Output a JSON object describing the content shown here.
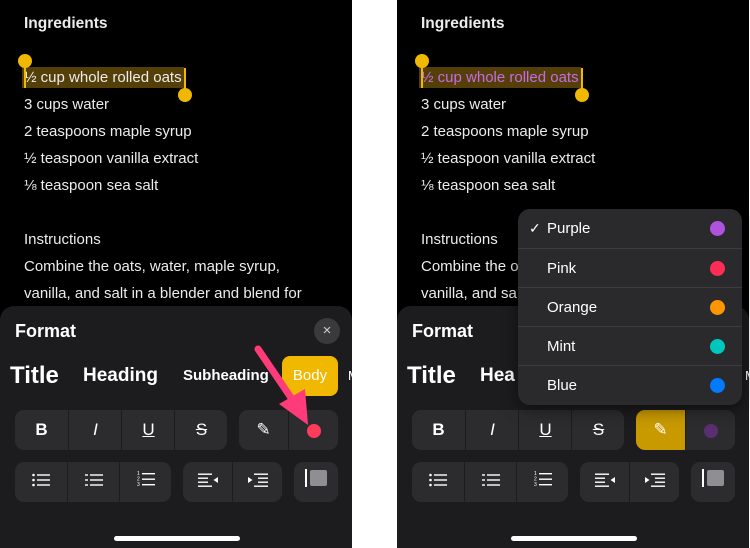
{
  "note": {
    "heading": "Ingredients",
    "lines": [
      "½ cup whole rolled oats",
      "3 cups water",
      "2 teaspoons maple syrup",
      "½ teaspoon vanilla extract",
      "⅛ teaspoon sea salt",
      "Instructions",
      "Combine the oats, water, maple syrup,",
      "vanilla, and salt in a blender and blend for"
    ],
    "right_lines_truncated": {
      "instructions_line1": "Combine the o",
      "instructions_line2": "vanilla, and sa"
    }
  },
  "format_panel": {
    "title": "Format",
    "close_icon": "×",
    "styles": {
      "title": "Title",
      "heading": "Heading",
      "heading_short": "Hea",
      "subheading": "Subheading",
      "body": "Body",
      "more": "M"
    },
    "text_buttons": {
      "bold": "B",
      "italic": "I",
      "underline": "U",
      "strikethrough": "S"
    },
    "highlight_icon": "✎"
  },
  "colors": {
    "accent": "#f0b800",
    "selected_text": "#c56be6",
    "left_dot": "#ff3b5c",
    "right_dot": "#5a2f72",
    "arrow": "#ff3b7a"
  },
  "color_menu": {
    "selected_check": "✓",
    "items": [
      {
        "label": "Purple",
        "color": "#af52de"
      },
      {
        "label": "Pink",
        "color": "#ff2d55"
      },
      {
        "label": "Orange",
        "color": "#ff9500"
      },
      {
        "label": "Mint",
        "color": "#00c7be"
      },
      {
        "label": "Blue",
        "color": "#007aff"
      }
    ]
  }
}
